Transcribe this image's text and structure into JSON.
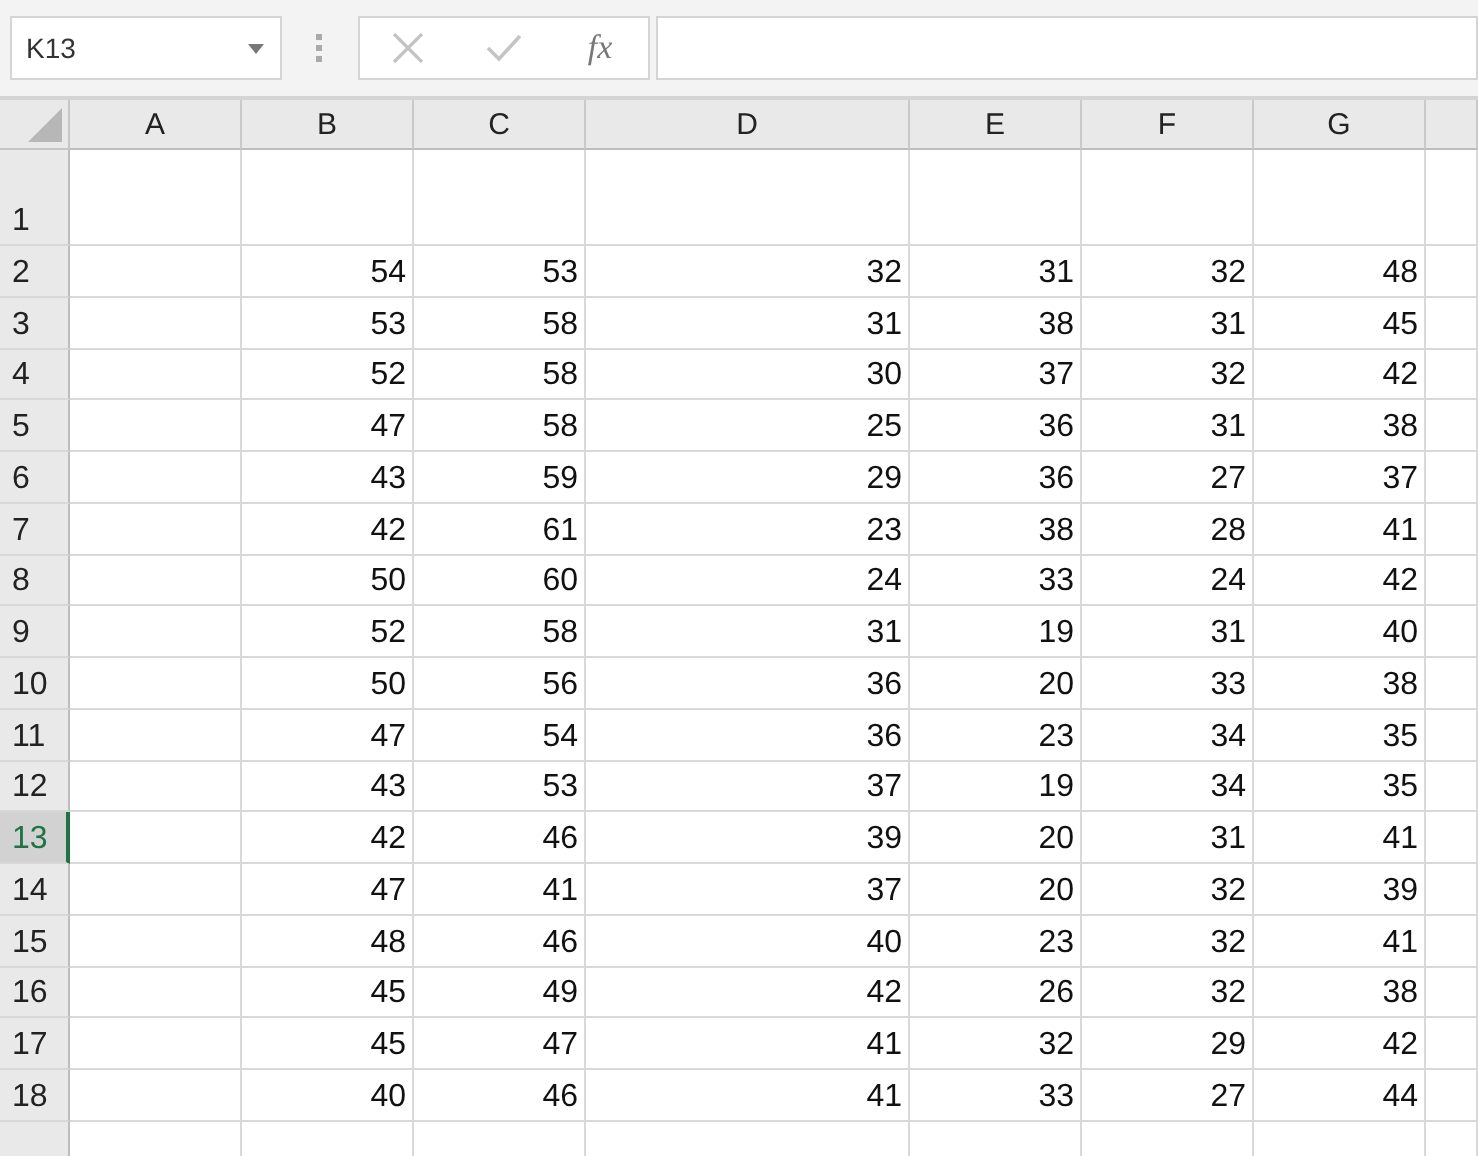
{
  "name_box": {
    "value": "K13"
  },
  "formula_bar": {
    "function_label": "fx"
  },
  "columns": [
    "A",
    "B",
    "C",
    "D",
    "E",
    "F",
    "G"
  ],
  "rows": [
    {
      "header": "1",
      "selected": false
    },
    {
      "header": "2",
      "selected": false,
      "values": [
        "54",
        "53",
        "32",
        "31",
        "32",
        "48"
      ]
    },
    {
      "header": "3",
      "selected": false,
      "values": [
        "53",
        "58",
        "31",
        "38",
        "31",
        "45"
      ]
    },
    {
      "header": "4",
      "selected": false,
      "values": [
        "52",
        "58",
        "30",
        "37",
        "32",
        "42"
      ]
    },
    {
      "header": "5",
      "selected": false,
      "values": [
        "47",
        "58",
        "25",
        "36",
        "31",
        "38"
      ]
    },
    {
      "header": "6",
      "selected": false,
      "values": [
        "43",
        "59",
        "29",
        "36",
        "27",
        "37"
      ]
    },
    {
      "header": "7",
      "selected": false,
      "values": [
        "42",
        "61",
        "23",
        "38",
        "28",
        "41"
      ]
    },
    {
      "header": "8",
      "selected": false,
      "values": [
        "50",
        "60",
        "24",
        "33",
        "24",
        "42"
      ]
    },
    {
      "header": "9",
      "selected": false,
      "values": [
        "52",
        "58",
        "31",
        "19",
        "31",
        "40"
      ]
    },
    {
      "header": "10",
      "selected": false,
      "values": [
        "50",
        "56",
        "36",
        "20",
        "33",
        "38"
      ]
    },
    {
      "header": "11",
      "selected": false,
      "values": [
        "47",
        "54",
        "36",
        "23",
        "34",
        "35"
      ]
    },
    {
      "header": "12",
      "selected": false,
      "values": [
        "43",
        "53",
        "37",
        "19",
        "34",
        "35"
      ]
    },
    {
      "header": "13",
      "selected": true,
      "values": [
        "42",
        "46",
        "39",
        "20",
        "31",
        "41"
      ]
    },
    {
      "header": "14",
      "selected": false,
      "values": [
        "47",
        "41",
        "37",
        "20",
        "32",
        "39"
      ]
    },
    {
      "header": "15",
      "selected": false,
      "values": [
        "48",
        "46",
        "40",
        "23",
        "32",
        "41"
      ]
    },
    {
      "header": "16",
      "selected": false,
      "values": [
        "45",
        "49",
        "42",
        "26",
        "32",
        "38"
      ]
    },
    {
      "header": "17",
      "selected": false,
      "values": [
        "45",
        "47",
        "41",
        "32",
        "29",
        "42"
      ]
    },
    {
      "header": "18",
      "selected": false,
      "values": [
        "40",
        "46",
        "41",
        "33",
        "27",
        "44"
      ]
    }
  ]
}
